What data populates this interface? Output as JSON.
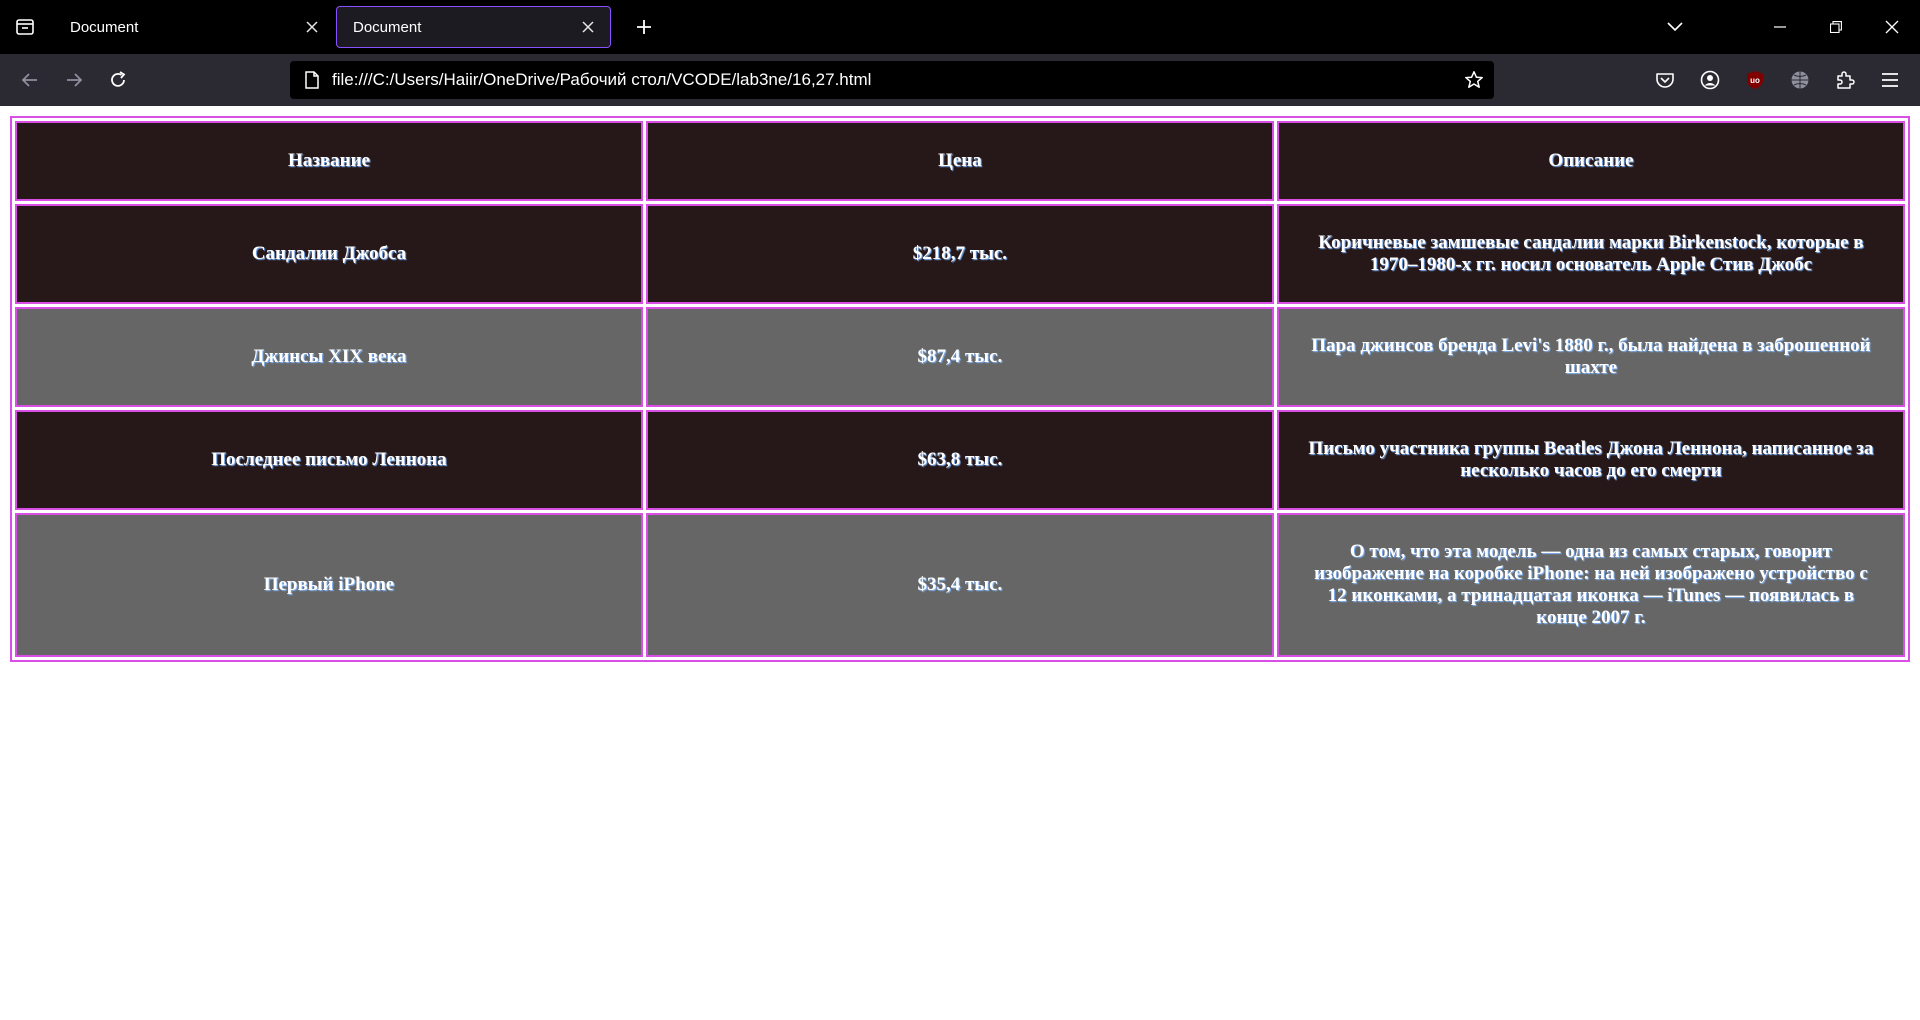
{
  "tabs": [
    {
      "title": "Document",
      "active": false
    },
    {
      "title": "Document",
      "active": true
    }
  ],
  "address": {
    "url": "file:///C:/Users/Haiir/OneDrive/Рабочий стол/VCODE/lab3ne/16,27.html"
  },
  "table": {
    "headers": [
      "Название",
      "Цена",
      "Описание"
    ],
    "rows": [
      {
        "name": "Сандалии Джобса",
        "price": "$218,7 тыс.",
        "desc": "Коричневые замшевые сандалии марки Birkenstock, которые в 1970–1980-х гг. носил основатель Apple Стив Джобс"
      },
      {
        "name": "Джинсы XIX века",
        "price": "$87,4 тыс.",
        "desc": "Пара джинсов бренда Levi's 1880 г., была найдена в заброшенной шахте"
      },
      {
        "name": "Последнее письмо Леннона",
        "price": "$63,8 тыс.",
        "desc": "Письмо участника группы Beatles Джона Леннона, написанное за несколько часов до его смерти"
      },
      {
        "name": "Первый iPhone",
        "price": "$35,4 тыс.",
        "desc": "О том, что эта модель — одна из самых старых, говорит изображение на коробке iPhone: на ней изображено устройство с 12 иконками, а тринадцатая иконка — iTunes — появилась в конце 2007 г."
      }
    ]
  },
  "colors": {
    "border": "#d94fe6",
    "row_dark": "#261719",
    "row_gray": "#666666",
    "text_shadow": "#7fb7ff"
  }
}
